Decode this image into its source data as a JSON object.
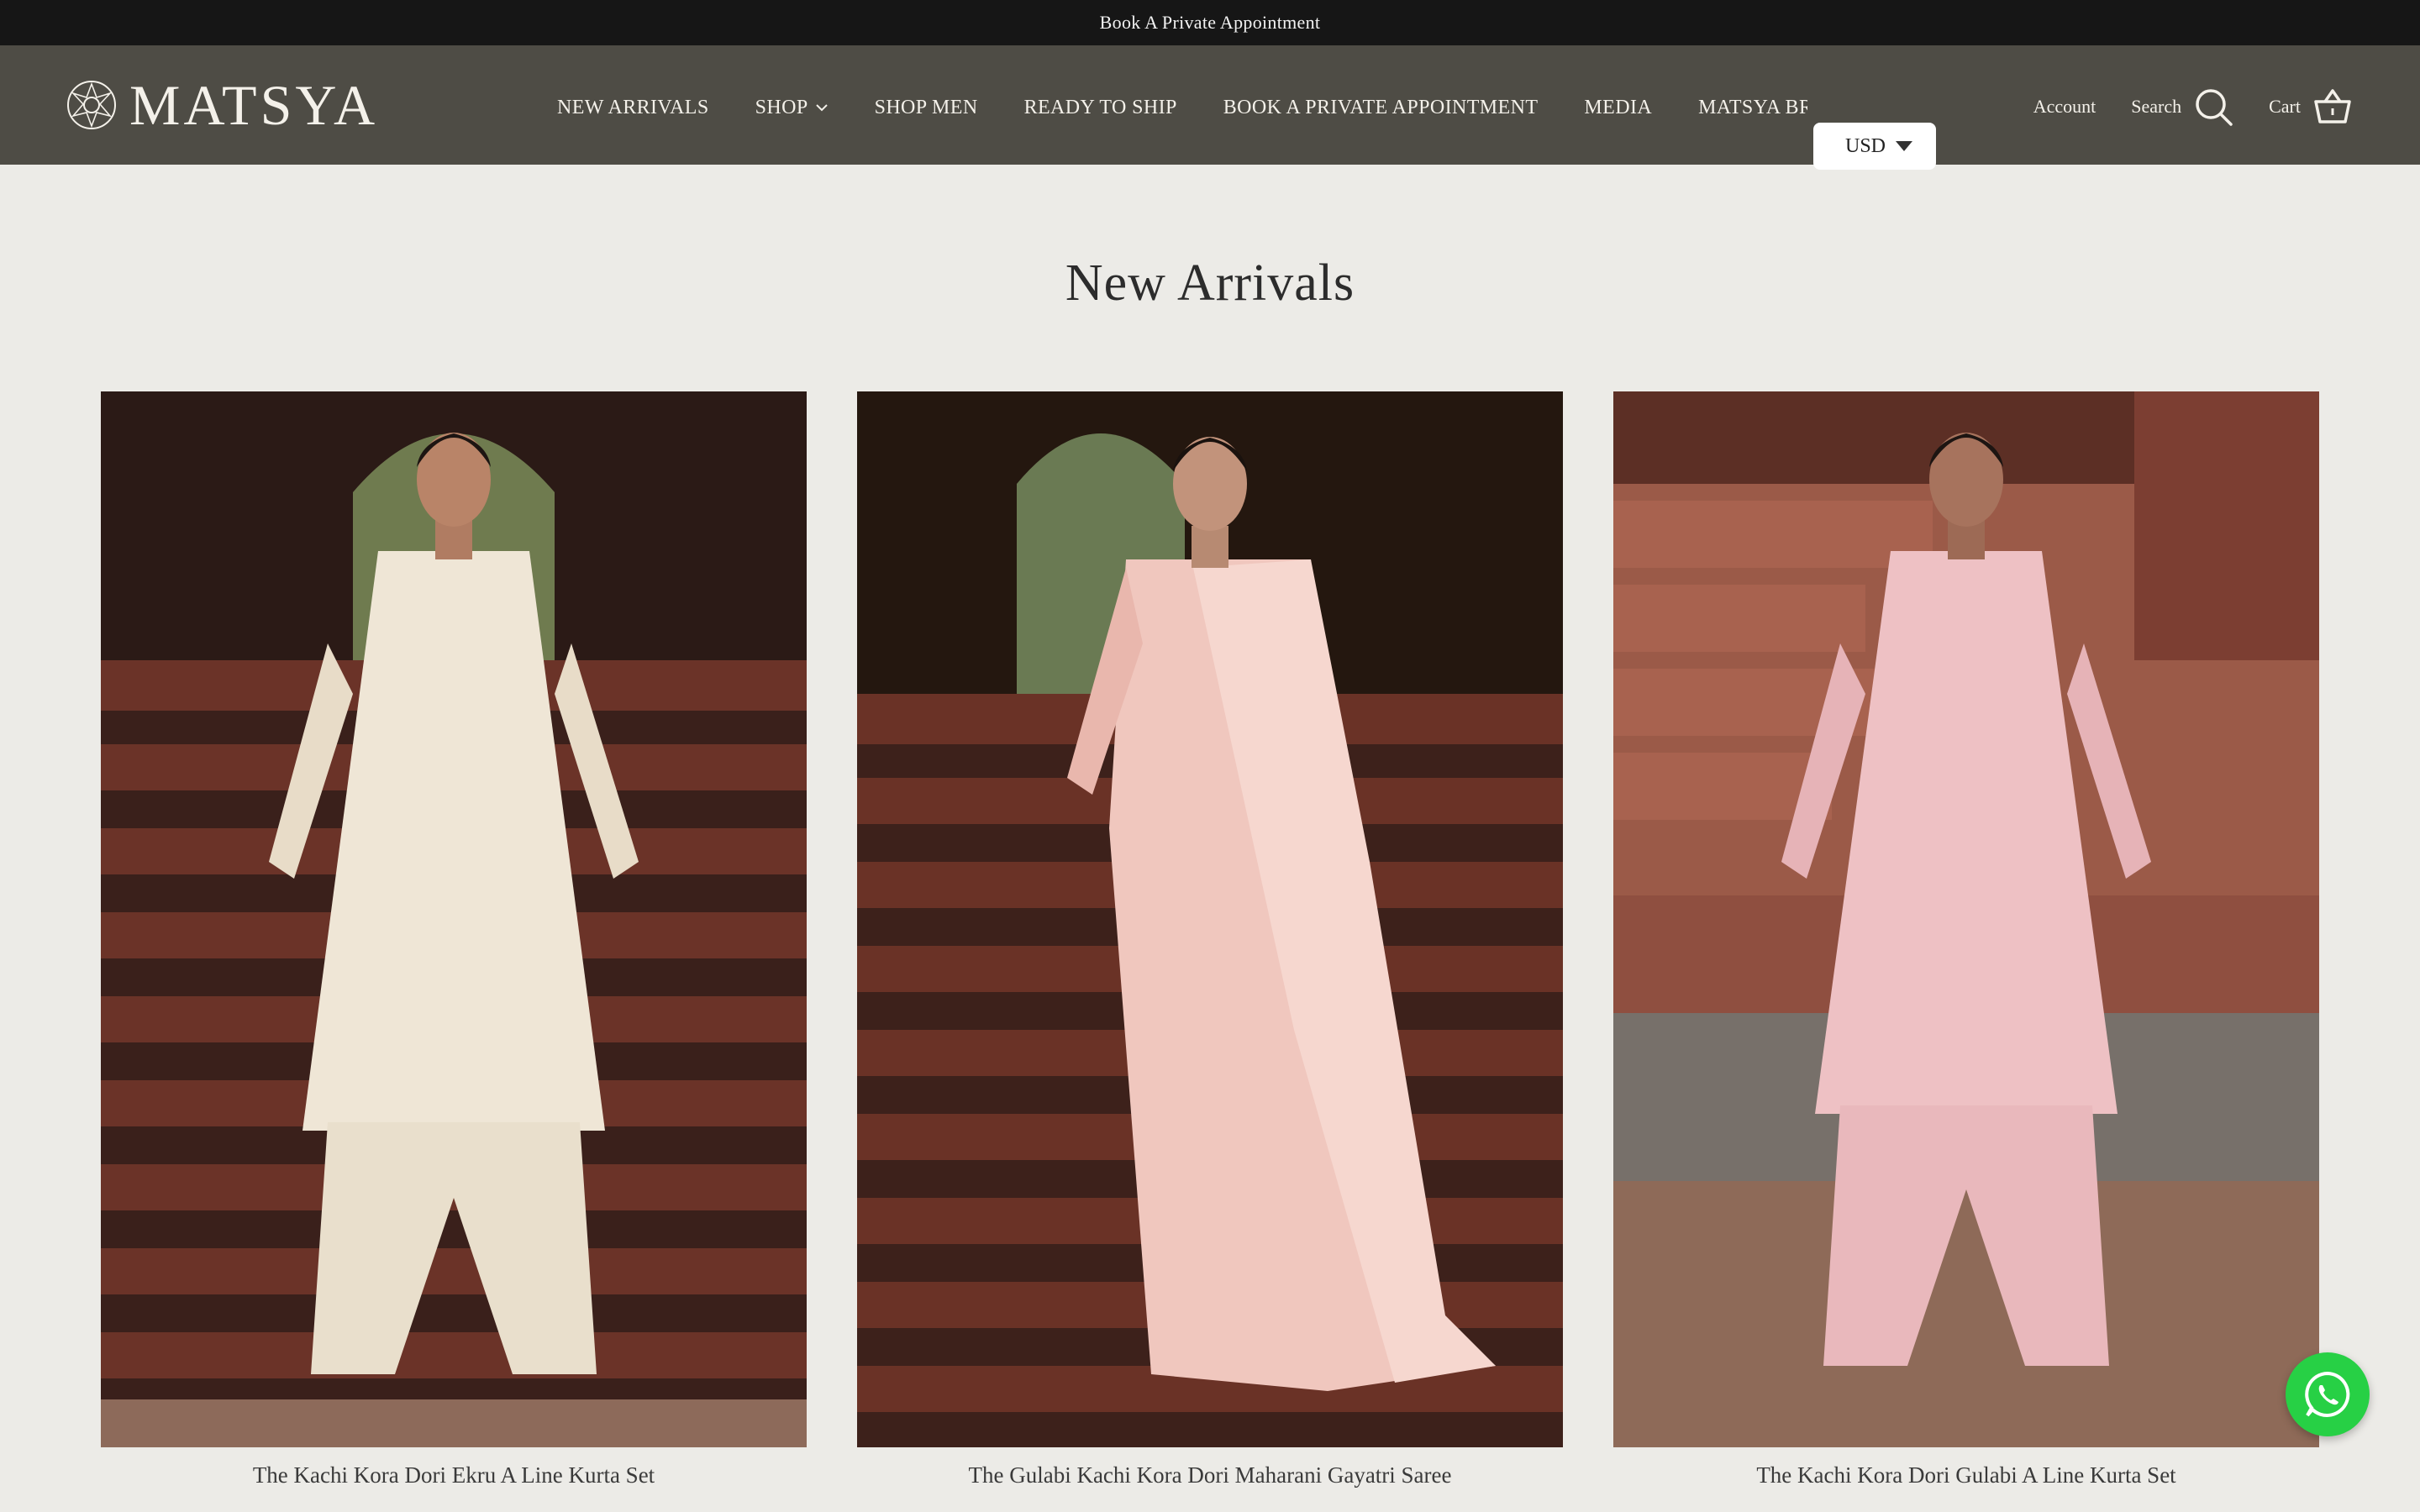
{
  "announcement": {
    "text": "Book A Private Appointment"
  },
  "header": {
    "logo_text": "MATSYA",
    "nav": [
      {
        "label": "NEW ARRIVALS"
      },
      {
        "label": "SHOP"
      },
      {
        "label": "SHOP MEN"
      },
      {
        "label": "READY TO SHIP"
      },
      {
        "label": "BOOK A PRIVATE APPOINTMENT"
      },
      {
        "label": "MEDIA"
      },
      {
        "label": "MATSYA BR"
      }
    ],
    "currency": "USD",
    "account_label": "Account",
    "search_label": "Search",
    "cart_label": "Cart"
  },
  "main": {
    "title": "New Arrivals",
    "products": [
      {
        "name": "The Kachi Kora Dori Ekru A Line Kurta Set",
        "garment_color": "#efe6d6",
        "bg": "#5e2d24"
      },
      {
        "name": "The Gulabi Kachi Kora Dori Maharani Gayatri Saree",
        "garment_color": "#f0c7be",
        "bg": "#5a2a22"
      },
      {
        "name": "The Kachi Kora Dori Gulabi A Line Kurta Set",
        "garment_color": "#eec1c4",
        "bg": "#8a4a3c"
      }
    ]
  },
  "colors": {
    "header_bg": "#4e4c45",
    "announce_bg": "#161616",
    "page_bg": "#ecebe7",
    "whatsapp": "#27d045"
  }
}
